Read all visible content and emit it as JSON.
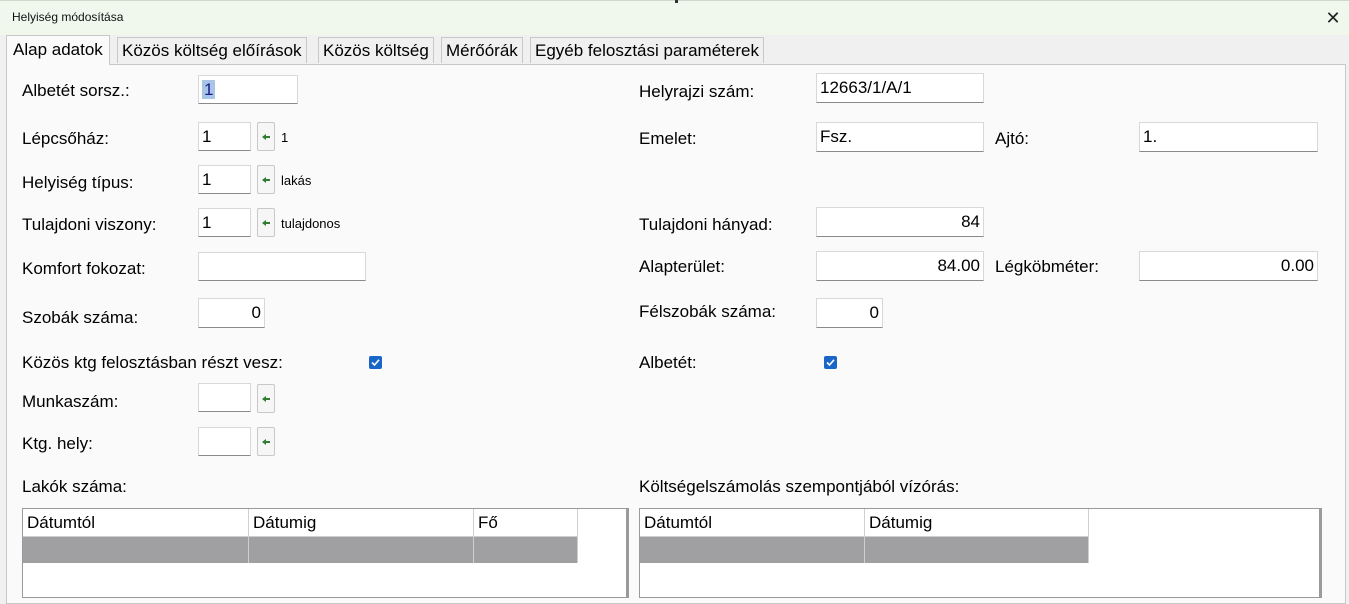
{
  "window": {
    "title": "Helyiség módosítása",
    "close_symbol": "✕"
  },
  "tabs": [
    {
      "label": "Alap adatok"
    },
    {
      "label": "Közös költség előírások"
    },
    {
      "label": "Közös költség"
    },
    {
      "label": "Mérőórák"
    },
    {
      "label": "Egyéb felosztási paraméterek"
    }
  ],
  "left": {
    "albetet_sorsz": {
      "label": "Albetét sorsz.:",
      "value": "1"
    },
    "lepcsohaz": {
      "label": "Lépcsőház:",
      "value": "1",
      "desc": "1"
    },
    "helyiseg_tipus": {
      "label": "Helyiség típus:",
      "value": "1",
      "desc": "lakás"
    },
    "tulajdoni_viszony": {
      "label": "Tulajdoni viszony:",
      "value": "1",
      "desc": "tulajdonos"
    },
    "komfort_fokozat": {
      "label": "Komfort fokozat:",
      "value": ""
    },
    "szobak_szama": {
      "label": "Szobák száma:",
      "value": "0"
    },
    "kozos_ktg": {
      "label": "Közös ktg felosztásban részt vesz:",
      "checked": true
    },
    "munkaszam": {
      "label": "Munkaszám:",
      "value": ""
    },
    "ktg_hely": {
      "label": "Ktg. hely:",
      "value": ""
    },
    "lakok_szama": {
      "label": "Lakók száma:"
    }
  },
  "right": {
    "helyrajzi_szam": {
      "label": "Helyrajzi szám:",
      "value": "12663/1/A/1"
    },
    "emelet": {
      "label": "Emelet:",
      "value": "Fsz."
    },
    "ajto": {
      "label": "Ajtó:",
      "value": "1."
    },
    "tulajdoni_hanyad": {
      "label": "Tulajdoni hányad:",
      "value": "84"
    },
    "alapterulet": {
      "label": "Alapterület:",
      "value": "84.00"
    },
    "legkobmeter": {
      "label": "Légköbméter:",
      "value": "0.00"
    },
    "felszobak_szama": {
      "label": "Félszobák száma:",
      "value": "0"
    },
    "albetet": {
      "label": "Albetét:",
      "checked": true
    },
    "vizoras": {
      "label": "Költségelszámolás szempontjából vízórás:"
    }
  },
  "lakok_table": {
    "columns": [
      "Dátumtól",
      "Dátumig",
      "Fő"
    ]
  },
  "vizoras_table": {
    "columns": [
      "Dátumtól",
      "Dátumig"
    ]
  },
  "colors": {
    "selected_row": "#a0a0a3",
    "checkbox": "#1a66c8",
    "picker_arrow": "#2e7d32"
  },
  "icons": {
    "picker": "arrow-left-icon",
    "close": "close-icon",
    "check": "check-icon"
  }
}
